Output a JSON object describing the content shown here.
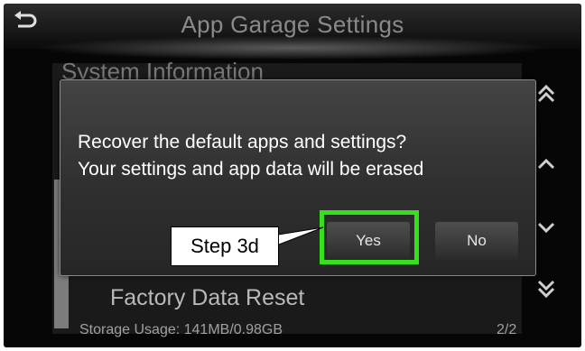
{
  "header": {
    "title": "App Garage Settings",
    "back_icon": "back-arrow-icon"
  },
  "list": {
    "partial_item": "System Information",
    "factory_reset_label": "Factory Data Reset",
    "storage_usage": "Storage Usage: 141MB/0.98GB",
    "page_indicator": "2/2"
  },
  "scroll": {
    "page_up_icon": "double-chevron-up-icon",
    "up_icon": "chevron-up-icon",
    "down_icon": "chevron-down-icon",
    "page_down_icon": "double-chevron-down-icon"
  },
  "dialog": {
    "line1": "Recover the default apps and settings?",
    "line2": "Your settings and app data will be erased",
    "yes_label": "Yes",
    "no_label": "No"
  },
  "annotation": {
    "callout_label": "Step 3d",
    "highlight_color": "#36e01c"
  }
}
